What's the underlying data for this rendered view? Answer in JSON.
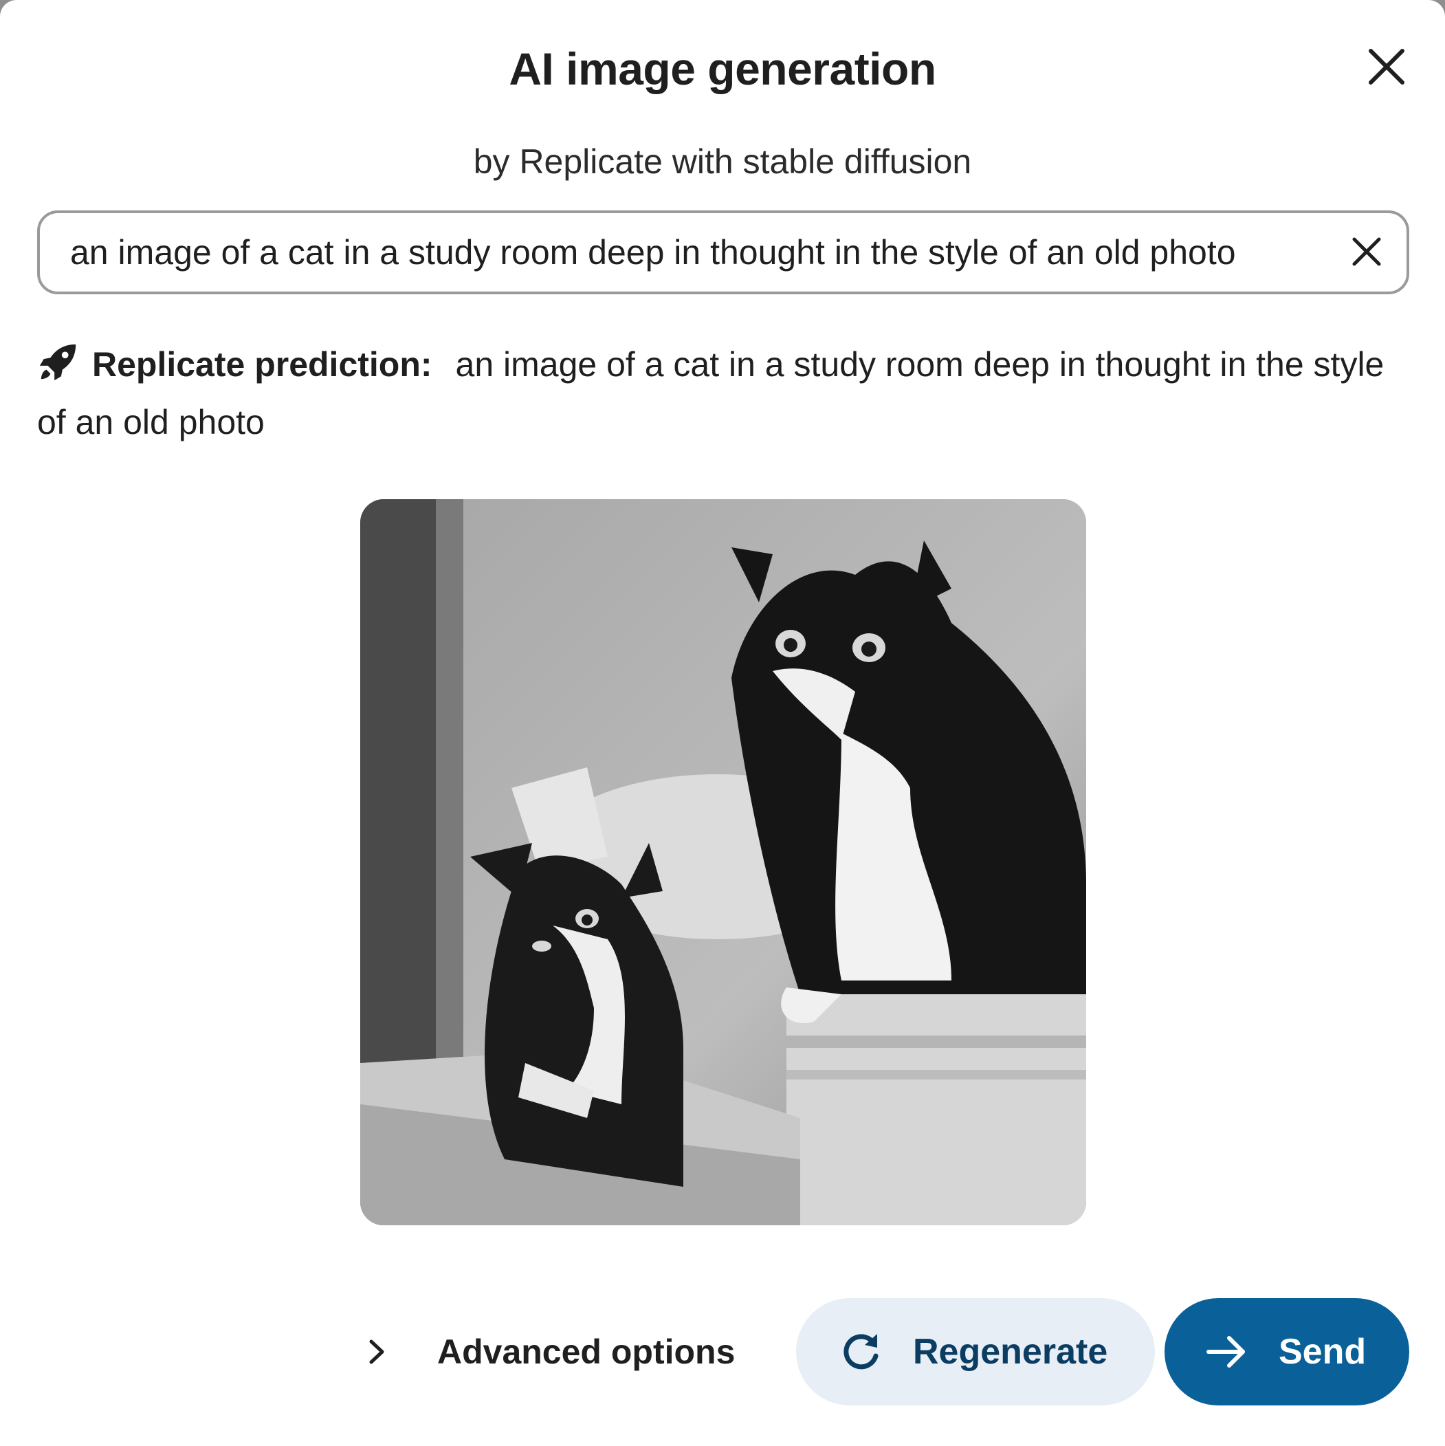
{
  "dialog": {
    "title": "AI image generation",
    "subtitle": "by Replicate with stable diffusion",
    "close_icon": "close-icon"
  },
  "prompt": {
    "value": "an image of a cat in a study room deep in thought in the style of an old photo",
    "clear_icon": "close-icon"
  },
  "prediction": {
    "icon": "rocket-icon",
    "label": "Replicate prediction:",
    "text": "an image of a cat in a study room deep in thought in the style of an old photo"
  },
  "footer": {
    "advanced_label": "Advanced options",
    "advanced_icon": "chevron-right-icon",
    "regenerate_label": "Regenerate",
    "regenerate_icon": "refresh-icon",
    "send_label": "Send",
    "send_icon": "arrow-right-icon"
  },
  "colors": {
    "primary": "#0a6099",
    "secondary_bg": "#e7eef6",
    "secondary_text": "#0b3c62",
    "border": "#9a9a9a"
  }
}
